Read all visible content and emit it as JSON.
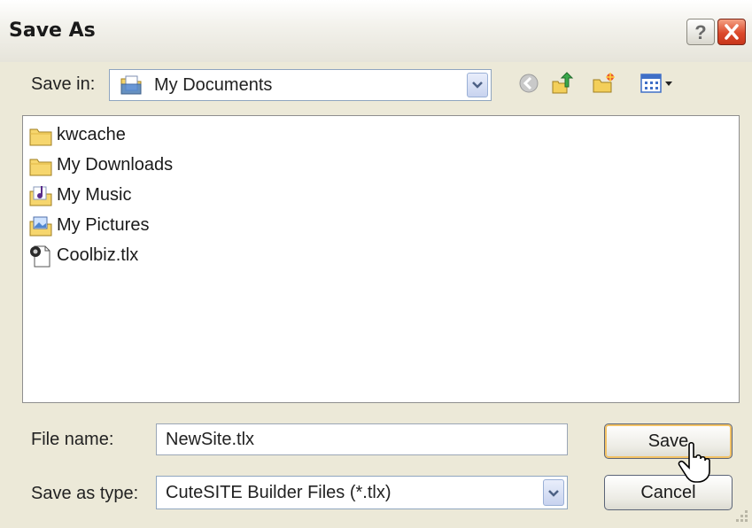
{
  "window": {
    "title": "Save As"
  },
  "title_buttons": {
    "help_glyph": "?"
  },
  "toolbar": {
    "save_in_label": "Save in:",
    "save_in_value": "My Documents",
    "icons": [
      "back-icon",
      "up-folder-icon",
      "new-folder-icon",
      "views-menu-icon"
    ]
  },
  "files": [
    {
      "name": "kwcache",
      "icon": "folder-icon"
    },
    {
      "name": "My Downloads",
      "icon": "folder-icon"
    },
    {
      "name": "My Music",
      "icon": "music-folder-icon"
    },
    {
      "name": "My Pictures",
      "icon": "pictures-folder-icon"
    },
    {
      "name": "Coolbiz.tlx",
      "icon": "tlx-file-icon"
    }
  ],
  "form": {
    "file_name_label": "File name:",
    "file_name_value": "NewSite.tlx",
    "save_type_label": "Save as type:",
    "save_type_value": "CuteSITE Builder Files (*.tlx)"
  },
  "buttons": {
    "save": "Save",
    "cancel": "Cancel"
  },
  "colors": {
    "close_button": "#dc4a2c",
    "dialog_bg": "#ece9d8",
    "default_button_ring": "#f3c265"
  }
}
